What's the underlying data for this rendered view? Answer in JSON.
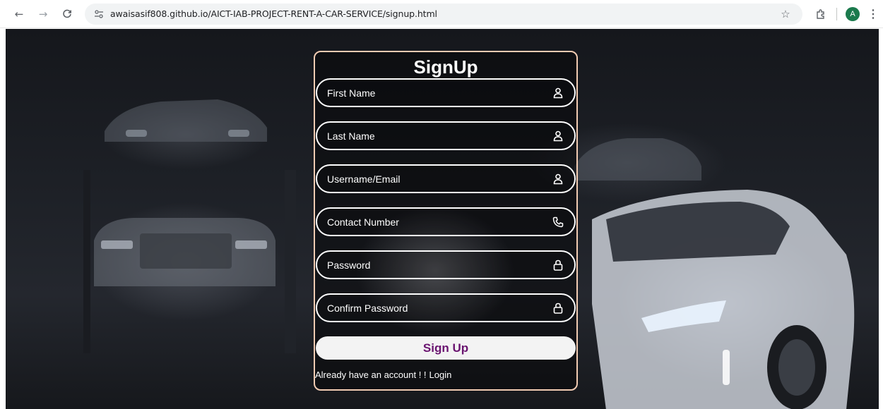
{
  "browser": {
    "url": "awaisasif808.github.io/AICT-IAB-PROJECT-RENT-A-CAR-SERVICE/signup.html",
    "profile_initial": "A",
    "profile_color": "#1b7a4d"
  },
  "form": {
    "title": "SignUp",
    "fields": [
      {
        "placeholder": "First Name",
        "icon": "user-icon"
      },
      {
        "placeholder": "Last Name",
        "icon": "user-icon"
      },
      {
        "placeholder": "Username/Email",
        "icon": "user-icon"
      },
      {
        "placeholder": "Contact Number",
        "icon": "phone-icon"
      },
      {
        "placeholder": "Password",
        "icon": "lock-icon"
      },
      {
        "placeholder": "Confirm Password",
        "icon": "lock-icon"
      }
    ],
    "submit_label": "Sign Up",
    "login_prompt": "Already have an account ! !",
    "login_link": "Login",
    "border_color": "#f1cbb2",
    "button_text_color": "#6a1470"
  }
}
